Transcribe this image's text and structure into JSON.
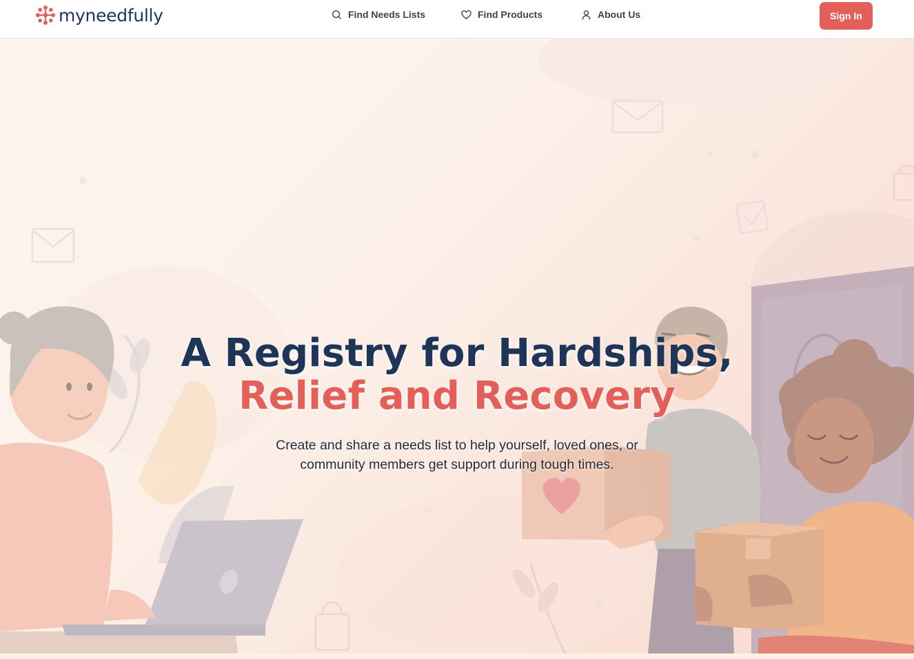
{
  "brand": {
    "name": "myneedfully",
    "accent_color": "#e3605a",
    "navy_color": "#1f3557"
  },
  "nav": {
    "items": [
      {
        "label": "Find Needs Lists",
        "icon": "search-icon"
      },
      {
        "label": "Find Products",
        "icon": "heart-icon"
      },
      {
        "label": "About Us",
        "icon": "user-icon"
      }
    ],
    "signin_label": "Sign In"
  },
  "hero": {
    "headline_line1": "A Registry for Hardships,",
    "headline_line2": "Relief and Recovery",
    "subtitle": "Create and share a needs list to help yourself, loved ones, or community members get support during tough times."
  }
}
